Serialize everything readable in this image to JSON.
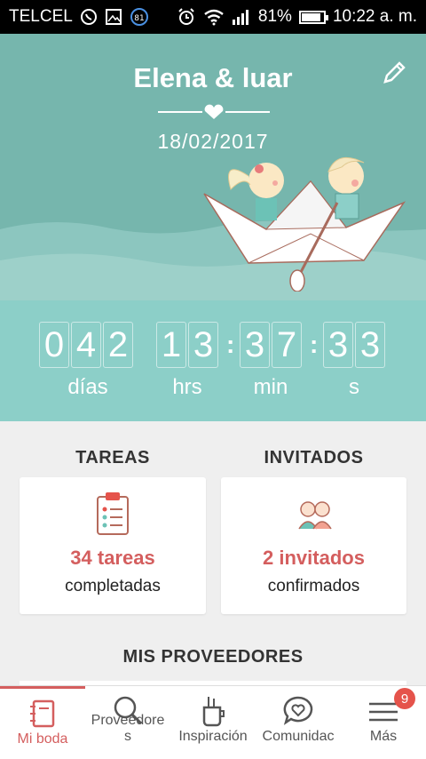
{
  "status_bar": {
    "carrier": "TELCEL",
    "notification_badge": "81",
    "battery": "81%",
    "battery_level": 0.81,
    "time": "10:22 a. m."
  },
  "header": {
    "title": "Elena & luar",
    "date": "18/02/2017",
    "background_color": "#76b6ad",
    "icons": [
      "edit-icon",
      "heart-icon"
    ]
  },
  "countdown": {
    "days_digits": [
      "0",
      "4",
      "2"
    ],
    "hours_digits": [
      "1",
      "3"
    ],
    "minutes_digits": [
      "3",
      "7"
    ],
    "seconds_digits": [
      "3",
      "3"
    ],
    "days_label": "días",
    "hours_label": "hrs",
    "minutes_label": "min",
    "seconds_label": "s",
    "separator": ":"
  },
  "tasks": {
    "title": "TAREAS",
    "count_text": "34 tareas",
    "sub_text": "completadas",
    "icon": "clipboard-icon"
  },
  "guests": {
    "title": "INVITADOS",
    "count_text": "2 invitados",
    "sub_text": "confirmados",
    "icon": "guests-icon"
  },
  "vendors": {
    "title": "MIS PROVEEDORES"
  },
  "bottom_nav": {
    "items": [
      {
        "label": "Mi boda",
        "icon": "notebook-icon",
        "active": true
      },
      {
        "label_line1": "Proveedore",
        "label_line2": "s",
        "icon": "search-icon"
      },
      {
        "label": "Inspiración",
        "icon": "inspiration-icon"
      },
      {
        "label": "Comunidac",
        "icon": "chat-heart-icon"
      },
      {
        "label": "Más",
        "icon": "menu-icon",
        "badge": "9"
      }
    ]
  },
  "colors": {
    "accent": "#d45e5e",
    "countdown_bg": "#8ccfc8",
    "header_bg": "#76b6ad"
  }
}
